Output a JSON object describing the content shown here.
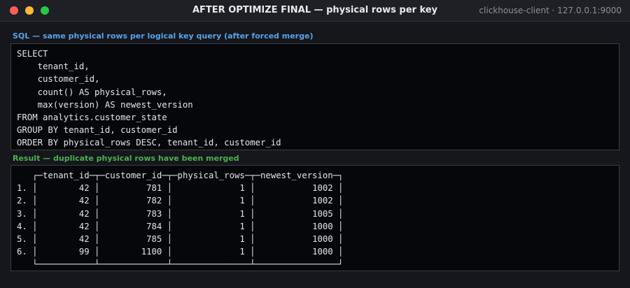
{
  "window": {
    "title": "AFTER OPTIMIZE FINAL — physical rows per key",
    "connection": "clickhouse-client · 127.0.0.1:9000"
  },
  "sql": {
    "label": "SQL — same physical rows per logical key query (after forced merge)",
    "lines": [
      "SELECT",
      "    tenant_id,",
      "    customer_id,",
      "    count() AS physical_rows,",
      "    max(version) AS newest_version",
      "FROM analytics.customer_state",
      "GROUP BY tenant_id, customer_id",
      "ORDER BY physical_rows DESC, tenant_id, customer_id"
    ]
  },
  "result": {
    "label": "Result — duplicate physical rows have been merged",
    "columns": [
      "tenant_id",
      "customer_id",
      "physical_rows",
      "newest_version"
    ],
    "rows": [
      {
        "num": "1.",
        "cells": [
          "42",
          "781",
          "1",
          "1002"
        ]
      },
      {
        "num": "2.",
        "cells": [
          "42",
          "782",
          "1",
          "1002"
        ]
      },
      {
        "num": "3.",
        "cells": [
          "42",
          "783",
          "1",
          "1005"
        ]
      },
      {
        "num": "4.",
        "cells": [
          "42",
          "784",
          "1",
          "1000"
        ]
      },
      {
        "num": "5.",
        "cells": [
          "42",
          "785",
          "1",
          "1000"
        ]
      },
      {
        "num": "6.",
        "cells": [
          "99",
          "1100",
          "1",
          "1000"
        ]
      }
    ]
  }
}
